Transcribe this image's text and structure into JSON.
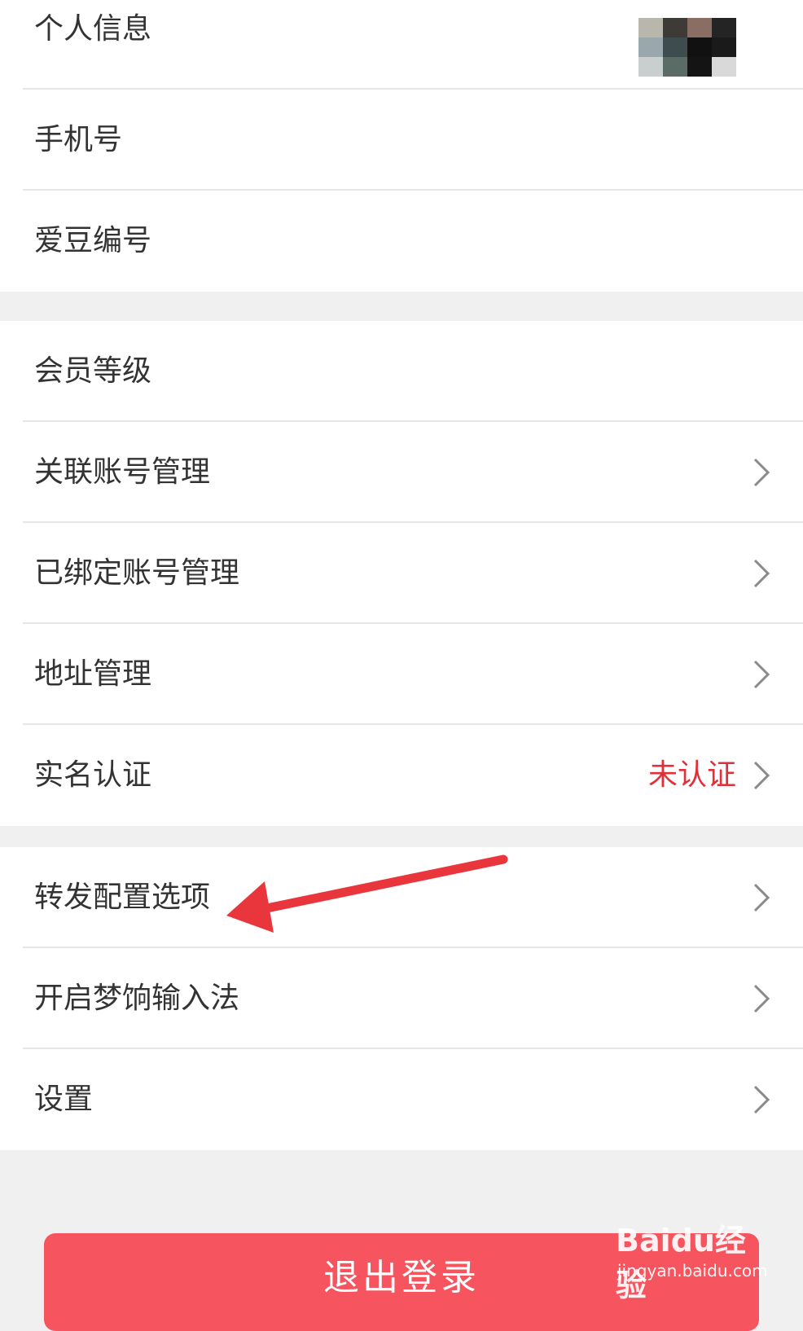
{
  "colors": {
    "accent_red": "#f6545e",
    "status_red": "#e0303a"
  },
  "menu": {
    "group1": [
      {
        "label": "个人信息"
      },
      {
        "label": "手机号"
      },
      {
        "label": "爱豆编号"
      }
    ],
    "group2": [
      {
        "label": "会员等级"
      },
      {
        "label": "关联账号管理"
      },
      {
        "label": "已绑定账号管理"
      },
      {
        "label": "地址管理"
      },
      {
        "label": "实名认证",
        "value": "未认证"
      }
    ],
    "group3": [
      {
        "label": "转发配置选项"
      },
      {
        "label": "开启梦饷输入法"
      },
      {
        "label": "设置"
      }
    ]
  },
  "logout": {
    "label": "退出登录"
  },
  "watermark": {
    "logo": "Baidu经验",
    "url": "jingyan.baidu.com"
  },
  "icons": {
    "chevron": "chevron-right-icon",
    "avatar": "avatar"
  }
}
